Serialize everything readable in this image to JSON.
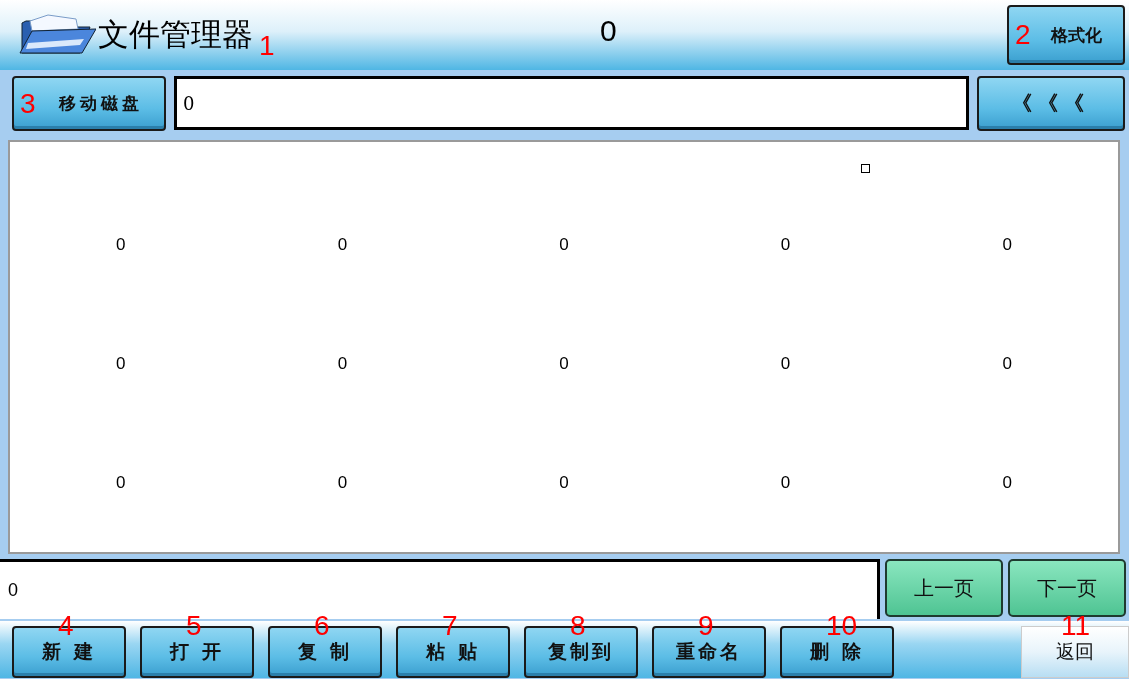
{
  "title_bar": {
    "title": "文件管理器",
    "title_callout": "1",
    "counter": "0",
    "format_button": {
      "label": "格式化",
      "callout": "2"
    }
  },
  "path_bar": {
    "drive_button": {
      "label": "移动磁盘",
      "callout": "3"
    },
    "path_value": "0",
    "back_button": {
      "label": "《《《"
    }
  },
  "file_grid": {
    "rows": [
      [
        "0",
        "0",
        "0",
        "0",
        "0"
      ],
      [
        "0",
        "0",
        "0",
        "0",
        "0"
      ],
      [
        "0",
        "0",
        "0",
        "0",
        "0"
      ]
    ]
  },
  "status_field": {
    "value": "0"
  },
  "page_buttons": [
    {
      "label": "上一页"
    },
    {
      "label": "下一页"
    }
  ],
  "action_buttons": [
    {
      "label": "新 建",
      "callout": "4"
    },
    {
      "label": "打 开",
      "callout": "5"
    },
    {
      "label": "复 制",
      "callout": "6"
    },
    {
      "label": "粘 贴",
      "callout": "7"
    },
    {
      "label": "复制到",
      "callout": "8"
    },
    {
      "label": "重命名",
      "callout": "9"
    },
    {
      "label": "删 除",
      "callout": "10"
    }
  ],
  "return_button": {
    "label": "返回",
    "callout": "11"
  }
}
